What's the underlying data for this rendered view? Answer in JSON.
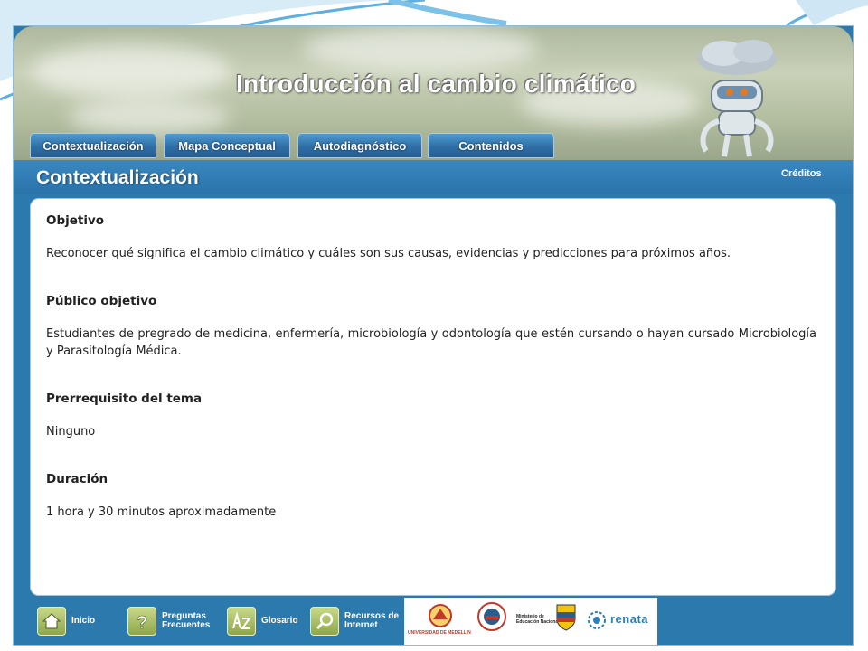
{
  "header": {
    "title": "Introducción al cambio climático"
  },
  "nav": {
    "tabs": [
      {
        "label": "Contextualización"
      },
      {
        "label": "Mapa Conceptual"
      },
      {
        "label": "Autodiagnóstico"
      },
      {
        "label": "Contenidos"
      }
    ],
    "credits": "Créditos"
  },
  "section": {
    "title": "Contextualización"
  },
  "content": {
    "blocks": [
      {
        "heading": "Objetivo",
        "text": "Reconocer qué significa el cambio climático y cuáles son sus causas, evidencias y predicciones para próximos años."
      },
      {
        "heading": "Público objetivo",
        "text": "Estudiantes de pregrado de medicina, enfermería, microbiología y odontología que estén cursando o hayan cursado Microbiología y Parasitología Médica."
      },
      {
        "heading": "Prerrequisito del tema",
        "text": "Ninguno"
      },
      {
        "heading": "Duración",
        "text": "1 hora y 30 minutos aproximadamente"
      }
    ]
  },
  "footer": {
    "buttons": [
      {
        "label": "Inicio",
        "icon": "home-icon"
      },
      {
        "label": "Preguntas Frecuentes",
        "icon": "question-icon"
      },
      {
        "label": "Glosario",
        "icon": "az-icon"
      },
      {
        "label": "Recursos de Internet",
        "icon": "magnifier-icon"
      }
    ],
    "logos": {
      "udem": "UNIVERSIDAD DE MEDELLIN",
      "ministerio_line1": "Ministerio de",
      "ministerio_line2": "Educación Nacional",
      "renata": "renata"
    }
  },
  "colors": {
    "frame_blue": "#2b79ad",
    "tab_blue": "#2f6fa6",
    "header_sage": "#b3bd9f",
    "footer_green": "#8ea64a"
  }
}
